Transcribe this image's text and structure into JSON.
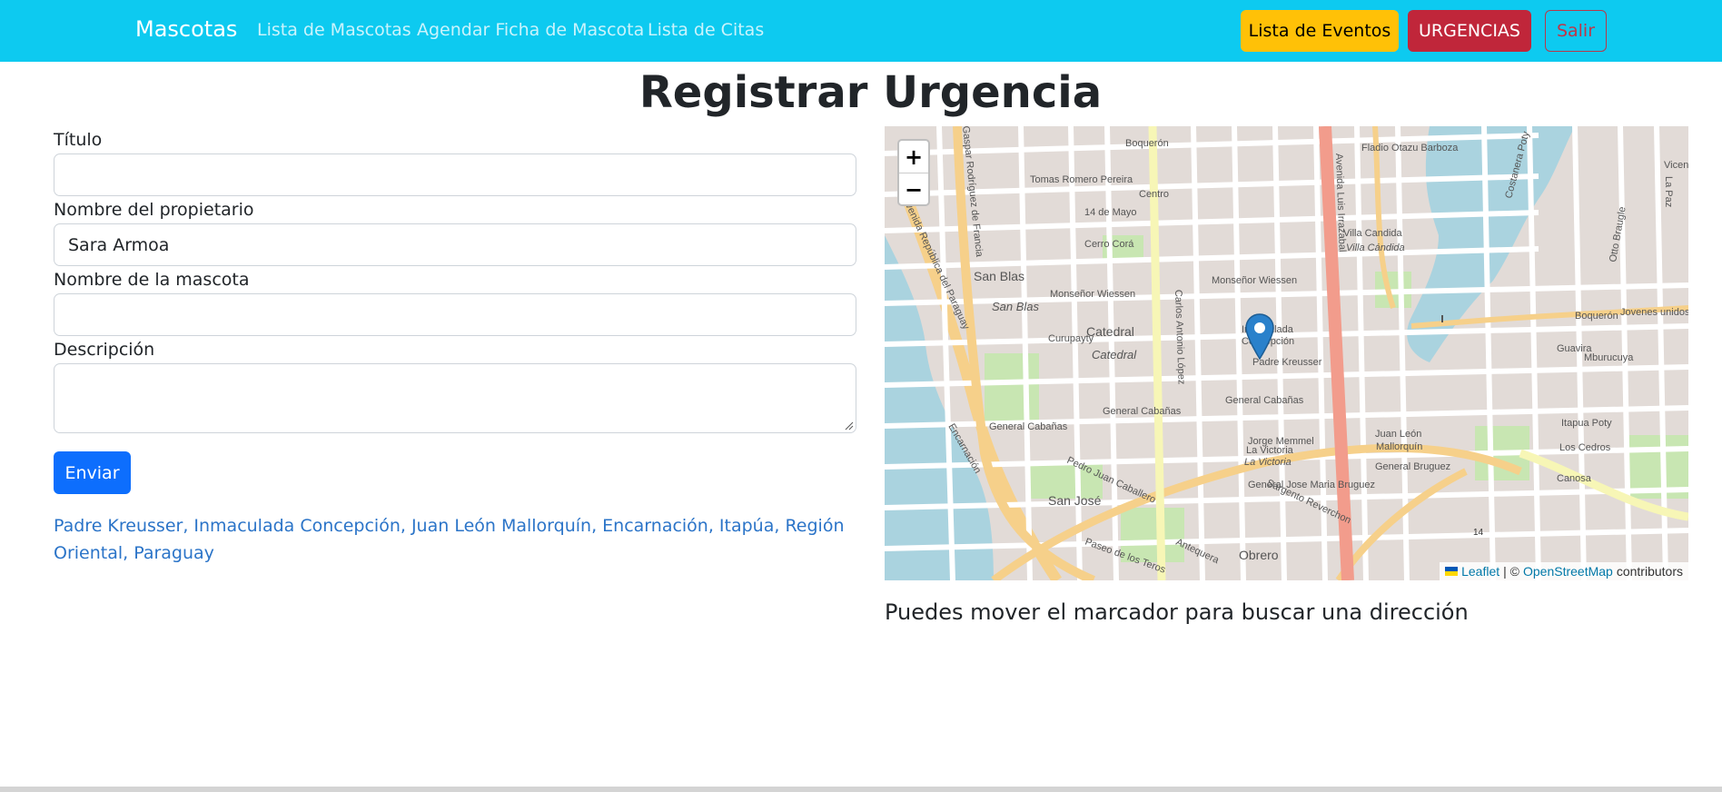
{
  "navbar": {
    "brand": "Mascotas",
    "links": [
      "Lista de Mascotas",
      "Agendar Ficha de Mascota",
      "Lista de Citas"
    ],
    "events_button": "Lista de Eventos",
    "urgent_button": "URGENCIAS",
    "logout_button": "Salir"
  },
  "page": {
    "title": "Registrar Urgencia"
  },
  "form": {
    "title_label": "Título",
    "title_value": "",
    "owner_label": "Nombre del propietario",
    "owner_value": "Sara Armoa",
    "pet_label": "Nombre de la mascota",
    "pet_value": "",
    "description_label": "Descripción",
    "description_value": "",
    "submit_label": "Enviar",
    "address": "Padre Kreusser, Inmaculada Concepción, Juan León Mallorquín, Encarnación, Itapúa, Región Oriental, Paraguay"
  },
  "map": {
    "zoom_in": "+",
    "zoom_out": "−",
    "attribution": {
      "leaflet": "Leaflet",
      "separator": "| ©",
      "osm": "OpenStreetMap",
      "contributors": "contributors"
    },
    "streets": [
      "Boquerón",
      "Centro",
      "San Blas",
      "Catedral",
      "Inmaculada Concepción",
      "Villa Candida",
      "Juan León Mallorquín",
      "La Victoria",
      "San José",
      "Obrero",
      "Avenida Luis Irrazabal",
      "Carlos Antonio López",
      "Gaspar Rodríguez de Francia",
      "Monseñor Wiessen",
      "General Cabañas",
      "Padre Kreusser",
      "Curupayty",
      "Cerro Corá",
      "14 de Mayo",
      "Tomas Romero Pereira",
      "Jorge Memmel",
      "Pedro Juan Caballero",
      "General Jose Maria Bruguez",
      "Sargento Reverchon",
      "Paseo de los Teros",
      "Antequera",
      "Costanera Poty",
      "Jovenes unidos",
      "Los Cedros",
      "Canosa",
      "Itapua Poty",
      "Mburucuya",
      "Guavira",
      "Otto Braugle",
      "Vicente I. B",
      "La Paz",
      "14"
    ],
    "pin_icon": "map-marker-icon",
    "colors": {
      "primary_road": "#f29c8c",
      "secondary_road": "#f6d08a",
      "tertiary_road": "#f7f6b6",
      "water": "#aad3df",
      "park": "#c8e6b2",
      "land": "#e2dbd7"
    }
  },
  "hint": "Puedes mover el marcador para buscar una dirección"
}
